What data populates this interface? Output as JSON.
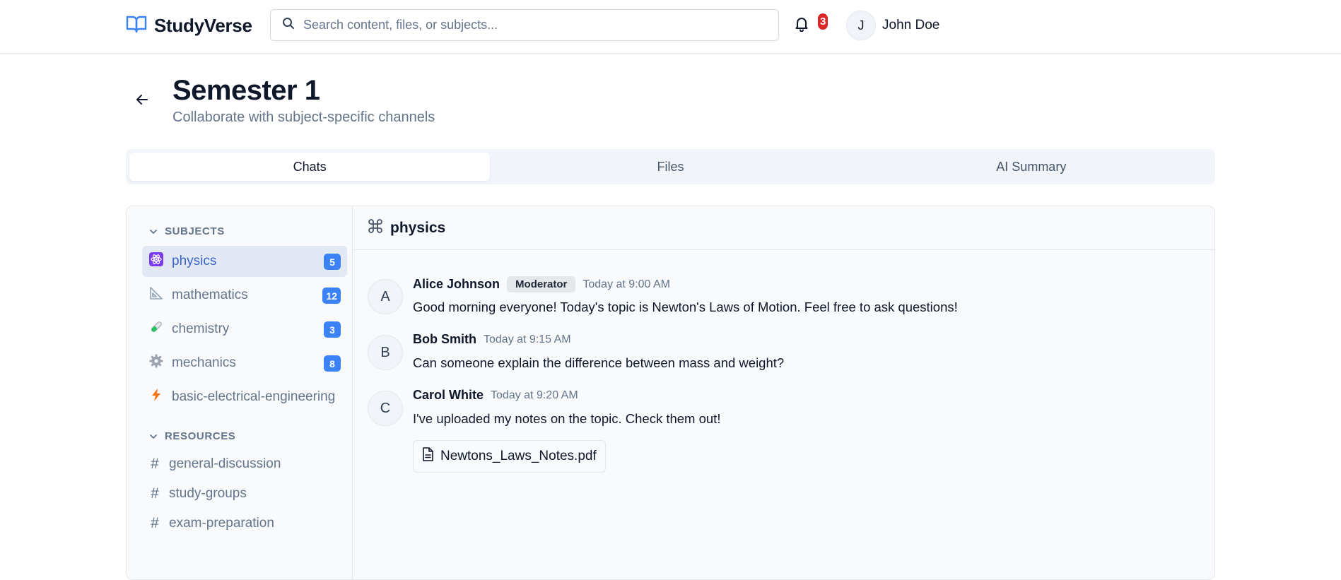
{
  "app": {
    "name": "StudyVerse"
  },
  "header": {
    "search_placeholder": "Search content, files, or subjects...",
    "notifications_count": "3",
    "user": {
      "initial": "J",
      "name": "John Doe"
    }
  },
  "page": {
    "title": "Semester 1",
    "subtitle": "Collaborate with subject-specific channels"
  },
  "tabs": [
    {
      "label": "Chats",
      "active": true
    },
    {
      "label": "Files",
      "active": false
    },
    {
      "label": "AI Summary",
      "active": false
    }
  ],
  "sidebar": {
    "subjects_heading": "SUBJECTS",
    "subjects": [
      {
        "name": "physics",
        "count": "5",
        "icon": "atom-icon",
        "active": true
      },
      {
        "name": "mathematics",
        "count": "12",
        "icon": "ruler-triangle-icon"
      },
      {
        "name": "chemistry",
        "count": "3",
        "icon": "test-tube-icon"
      },
      {
        "name": "mechanics",
        "count": "8",
        "icon": "gear-icon"
      },
      {
        "name": "basic-electrical-engineering",
        "count": "",
        "icon": "lightning-icon"
      }
    ],
    "resources_heading": "RESOURCES",
    "resources": [
      {
        "name": "general-discussion"
      },
      {
        "name": "study-groups"
      },
      {
        "name": "exam-preparation"
      }
    ]
  },
  "chat": {
    "channel": "physics",
    "messages": [
      {
        "initial": "A",
        "author": "Alice Johnson",
        "role": "Moderator",
        "time": "Today at 9:00 AM",
        "text": "Good morning everyone! Today's topic is Newton's Laws of Motion. Feel free to ask questions!"
      },
      {
        "initial": "B",
        "author": "Bob Smith",
        "role": "",
        "time": "Today at 9:15 AM",
        "text": "Can someone explain the difference between mass and weight?"
      },
      {
        "initial": "C",
        "author": "Carol White",
        "role": "",
        "time": "Today at 9:20 AM",
        "text": "I've uploaded my notes on the topic. Check them out!",
        "attachment": "Newtons_Laws_Notes.pdf"
      }
    ]
  },
  "colors": {
    "accent": "#3b82f6",
    "active_text": "#3b63c9",
    "notification": "#dc2626"
  }
}
